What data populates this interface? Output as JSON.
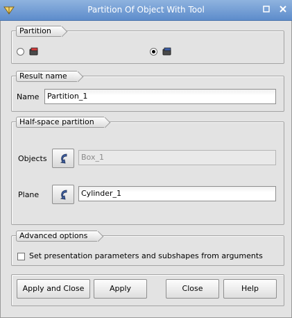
{
  "window": {
    "title": "Partition Of Object With Tool"
  },
  "partition": {
    "group_label": "Partition"
  },
  "result": {
    "group_label": "Result name",
    "name_label": "Name",
    "name_value": "Partition_1"
  },
  "half_space": {
    "group_label": "Half-space partition",
    "objects_label": "Objects",
    "objects_value": "Box_1",
    "plane_label": "Plane",
    "plane_value": "Cylinder_1"
  },
  "advanced": {
    "group_label": "Advanced options",
    "checkbox_label": "Set presentation parameters and subshapes from arguments"
  },
  "buttons": {
    "apply_close": "Apply and Close",
    "apply": "Apply",
    "close": "Close",
    "help": "Help"
  },
  "colors": {
    "titlebar": "#6e98d1",
    "window_bg": "#e3e3e3"
  }
}
